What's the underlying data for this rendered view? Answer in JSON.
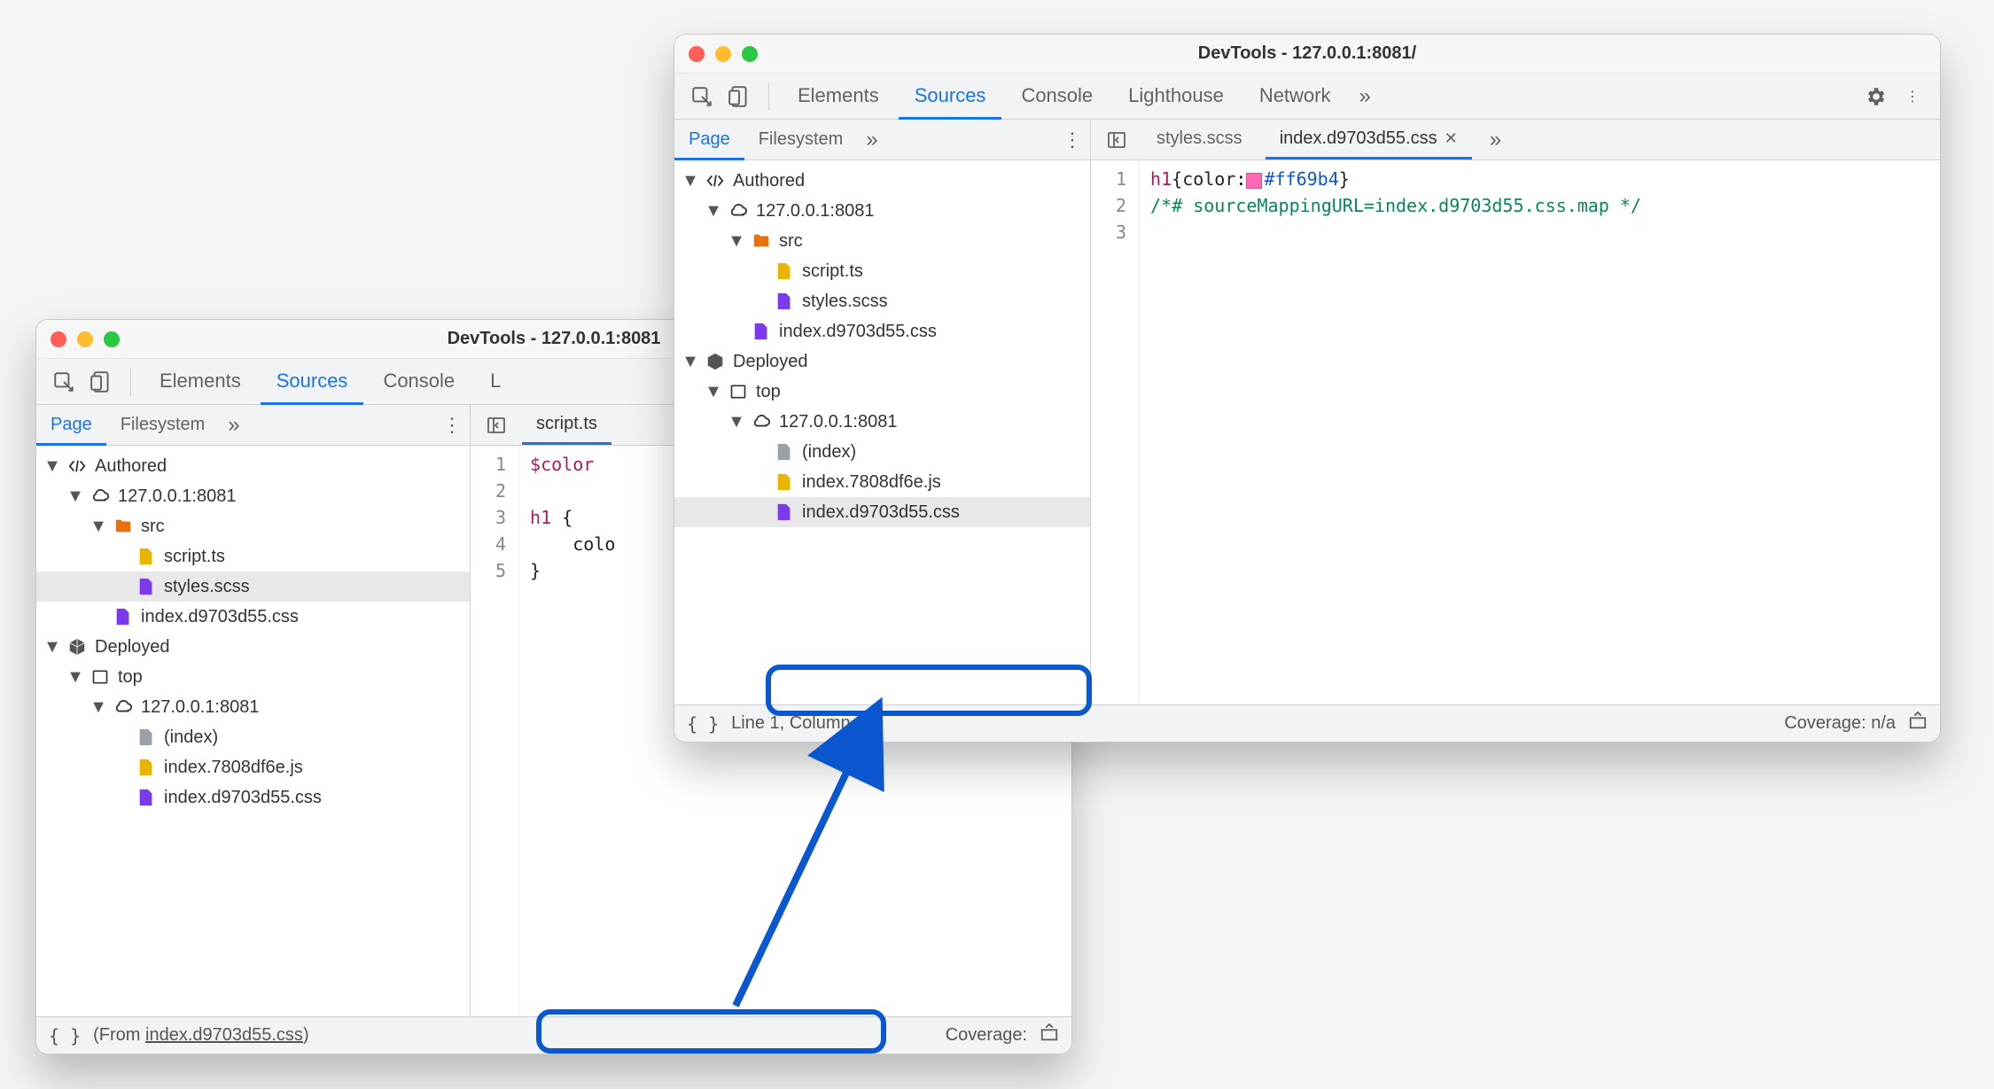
{
  "windowA": {
    "title": "DevTools - 127.0.0.1:8081",
    "tabs": [
      "Elements",
      "Sources",
      "Console",
      "L"
    ],
    "activeTabIndex": 1,
    "subtabs": [
      "Page",
      "Filesystem"
    ],
    "activeSubtabIndex": 0,
    "fileTabs": [
      "script.ts"
    ],
    "tree": {
      "authored": "Authored",
      "host": "127.0.0.1:8081",
      "srcFolder": "src",
      "scriptTs": "script.ts",
      "stylesScss": "styles.scss",
      "indexCss": "index.d9703d55.css",
      "deployed": "Deployed",
      "top": "top",
      "hostDeployed": "127.0.0.1:8081",
      "indexFile": "(index)",
      "indexJs": "index.7808df6e.js",
      "indexCssDeployed": "index.d9703d55.css"
    },
    "code": {
      "line1": "$color",
      "line3_sel": "h1",
      "line3_brace": " {",
      "line4": "    colo",
      "line5": "}",
      "lineNumbers": "1\n2\n3\n4\n5"
    },
    "status": {
      "from": "(From ",
      "fromFile": "index.d9703d55.css",
      "fromEnd": ")",
      "coverage": "Coverage:"
    }
  },
  "windowB": {
    "title": "DevTools - 127.0.0.1:8081/",
    "tabs": [
      "Elements",
      "Sources",
      "Console",
      "Lighthouse",
      "Network"
    ],
    "activeTabIndex": 1,
    "subtabs": [
      "Page",
      "Filesystem"
    ],
    "activeSubtabIndex": 0,
    "fileTabs": [
      {
        "label": "styles.scss",
        "active": false,
        "closable": false
      },
      {
        "label": "index.d9703d55.css",
        "active": true,
        "closable": true
      }
    ],
    "tree": {
      "authored": "Authored",
      "host": "127.0.0.1:8081",
      "srcFolder": "src",
      "scriptTs": "script.ts",
      "stylesScss": "styles.scss",
      "indexCss": "index.d9703d55.css",
      "deployed": "Deployed",
      "top": "top",
      "hostDeployed": "127.0.0.1:8081",
      "indexFile": "(index)",
      "indexJs": "index.7808df6e.js",
      "indexCssDeployed": "index.d9703d55.css"
    },
    "code": {
      "lineNumbers": "1\n2\n3",
      "sel": "h1",
      "brace1": "{",
      "prop": "color",
      "colon": ":",
      "hex": "#ff69b4",
      "brace2": "}",
      "comment": "/*# sourceMappingURL=index.d9703d55.css.map */"
    },
    "status": {
      "linecol": "Line 1, Column 1",
      "coverage": "Coverage: n/a"
    }
  }
}
